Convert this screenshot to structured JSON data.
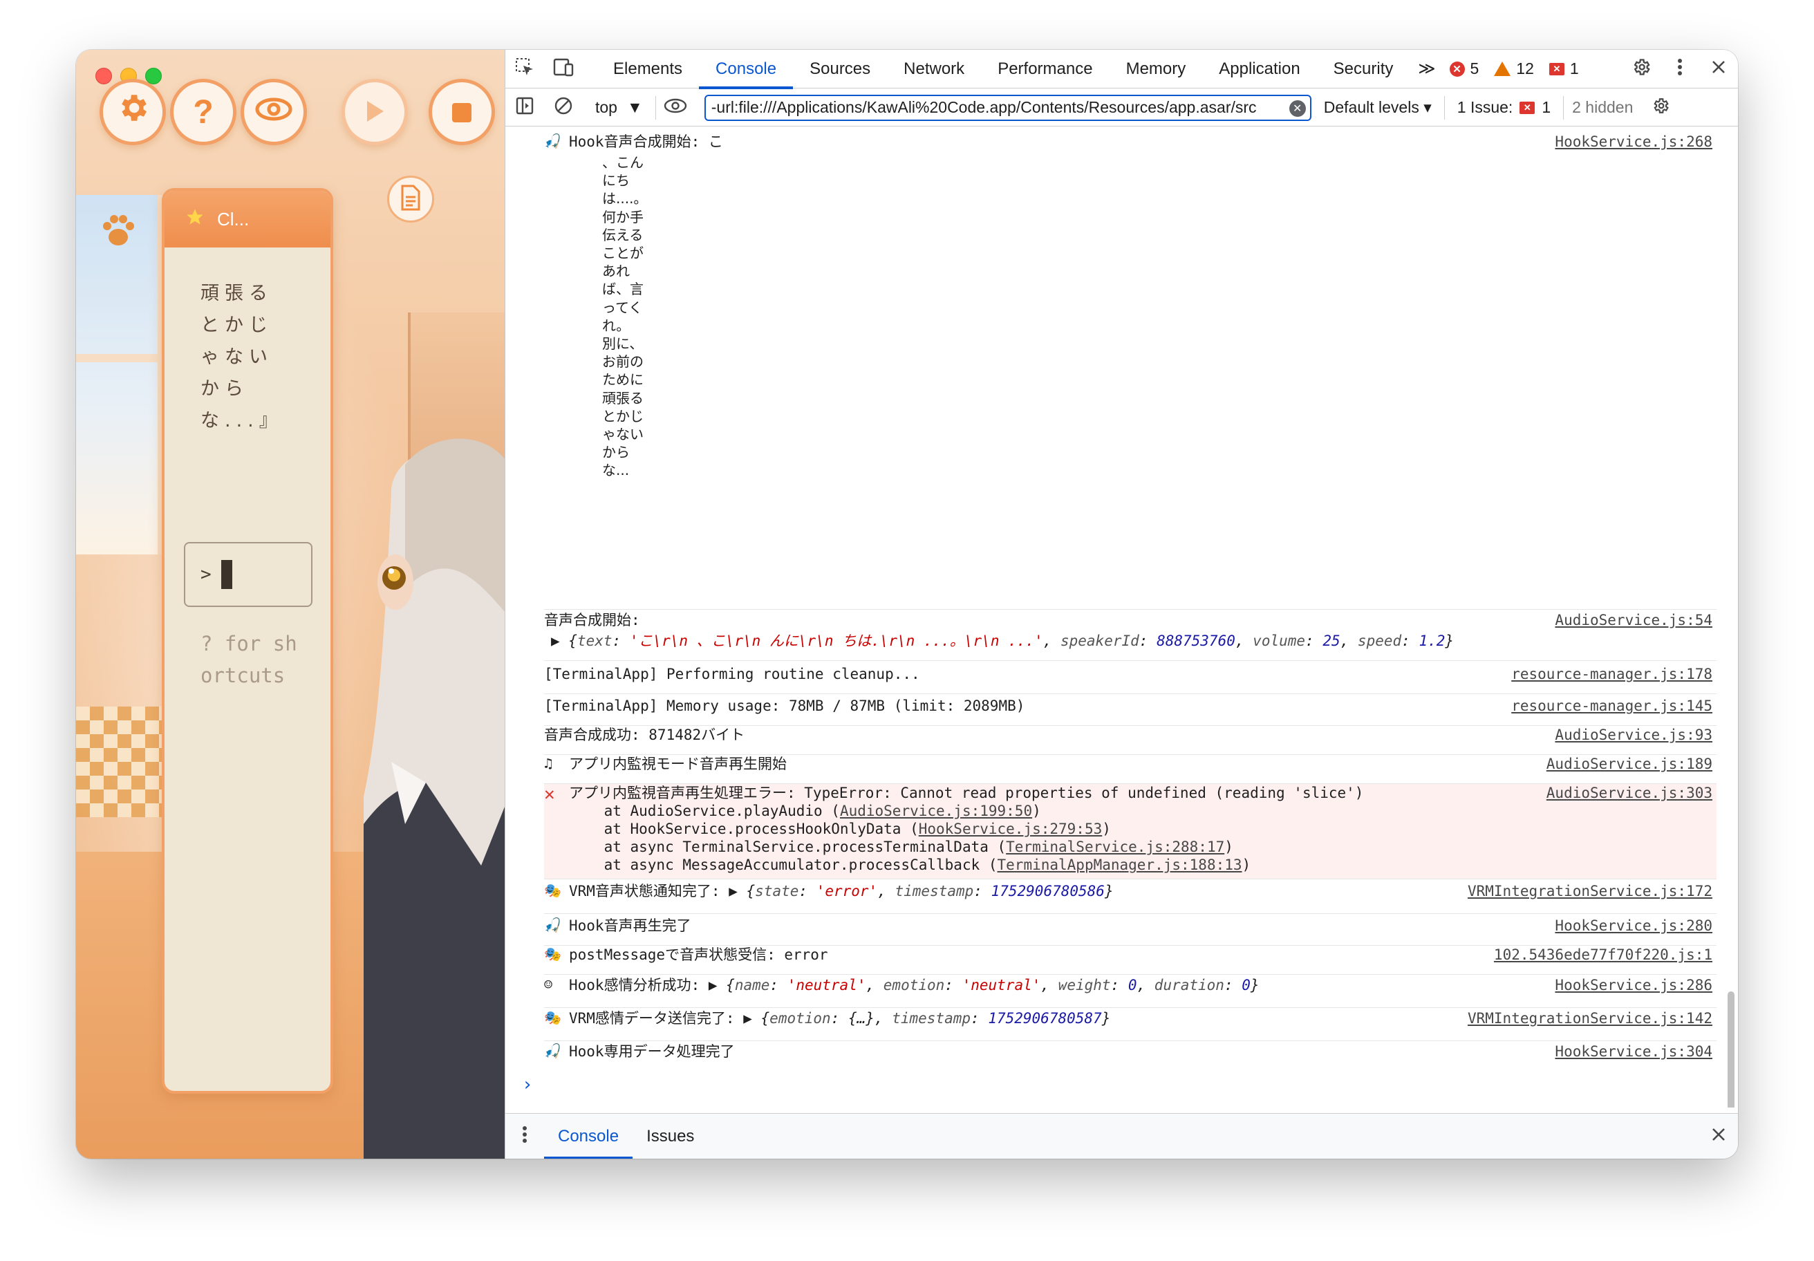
{
  "app": {
    "panel_title": "Cl...",
    "panel_text": "頑張るとかじゃないからな...』",
    "input_prompt": ">",
    "hint": "? for shortcuts",
    "buttons": {
      "settings": "settings-gear",
      "help": "?",
      "view": "eye",
      "play": "play",
      "stop": "stop"
    }
  },
  "devtools": {
    "tabs": [
      "Elements",
      "Console",
      "Sources",
      "Network",
      "Performance",
      "Memory",
      "Application",
      "Security"
    ],
    "active_tab": "Console",
    "more_tabs": "≫",
    "counts": {
      "errors": "5",
      "warnings": "12",
      "issues": "1"
    },
    "toolbar": {
      "context": "top",
      "filter_value": "-url:file:///Applications/KawAli%20Code.app/Contents/Resources/app.asar/src",
      "levels": "Default levels ▾",
      "issues_label": "1 Issue:",
      "issues_count": "1",
      "hidden": "2 hidden"
    },
    "drawer_tabs": [
      "Console",
      "Issues"
    ],
    "colors": {
      "accent": "#0b57d0",
      "error": "#dc362e",
      "warning": "#e37400"
    }
  },
  "console": {
    "messages": {
      "m0": {
        "text": "Hook音声合成開始: こ",
        "source": "HookService.js:268",
        "vertical": "、こんにちは....。何か手伝えることがあれば、言ってくれ。別に、お前のために頑張るとかじゃないからな..."
      },
      "m1": {
        "text": "音声合成開始:",
        "source": "AudioService.js:54"
      },
      "m1b": {
        "open": "▶ {",
        "k_text": "text",
        "v_text": "'こ\\r\\n 、こ\\r\\n んに\\r\\n ちは.\\r\\n ...。\\r\\n ...'",
        "k_speaker": "speakerId",
        "v_speaker": "888753760",
        "k_volume": "volume",
        "v_volume": "25",
        "k_speed": "speed",
        "v_speed": "1.2",
        "close": "}"
      },
      "m2": {
        "text": "[TerminalApp] Performing routine cleanup...",
        "source": "resource-manager.js:178"
      },
      "m3": {
        "text": "[TerminalApp] Memory usage: 78MB / 87MB (limit: 2089MB)",
        "source": "resource-manager.js:145"
      },
      "m4": {
        "text": "音声合成成功: 871482バイト",
        "source": "AudioService.js:93"
      },
      "m5": {
        "text": "アプリ内監視モード音声再生開始",
        "source": "AudioService.js:189"
      },
      "m6": {
        "text": "アプリ内監視音声再生処理エラー: TypeError: Cannot read properties of undefined (reading 'slice')",
        "source": "AudioService.js:303",
        "stack": [
          {
            "pre": "    at AudioService.playAudio (",
            "loc": "AudioService.js:199:50",
            "post": ")"
          },
          {
            "pre": "    at HookService.processHookOnlyData (",
            "loc": "HookService.js:279:53",
            "post": ")"
          },
          {
            "pre": "    at async TerminalService.processTerminalData (",
            "loc": "TerminalService.js:288:17",
            "post": ")"
          },
          {
            "pre": "    at async MessageAccumulator.processCallback (",
            "loc": "TerminalAppManager.js:188:13",
            "post": ")"
          }
        ]
      },
      "m7": {
        "text": "VRM音声状態通知完了:",
        "obj_open": "▶ {",
        "k1": "state",
        "v1": "'error'",
        "k2": "timestamp",
        "v2": "1752906780586",
        "obj_close": "}",
        "source": "VRMIntegrationService.js:172"
      },
      "m8": {
        "text": "Hook音声再生完了",
        "source": "HookService.js:280"
      },
      "m9": {
        "text": "postMessageで音声状態受信: error",
        "source": "102.5436ede77f70f220.js:1"
      },
      "m10": {
        "text": "Hook感情分析成功:",
        "obj_open": "▶ {",
        "k1": "name",
        "v1": "'neutral'",
        "k2": "emotion",
        "v2": "'neutral'",
        "k3": "weight",
        "v3": "0",
        "k4": "duration",
        "v4": "0",
        "obj_close": "}",
        "source": "HookService.js:286"
      },
      "m11": {
        "text": "VRM感情データ送信完了:",
        "obj_open": "▶ {",
        "k1": "emotion",
        "v1": "{…}",
        "k2": "timestamp",
        "v2": "1752906780587",
        "obj_close": "}",
        "source": "VRMIntegrationService.js:142"
      },
      "m12": {
        "text": "Hook専用データ処理完了",
        "source": "HookService.js:304"
      }
    },
    "prompt": "›"
  }
}
